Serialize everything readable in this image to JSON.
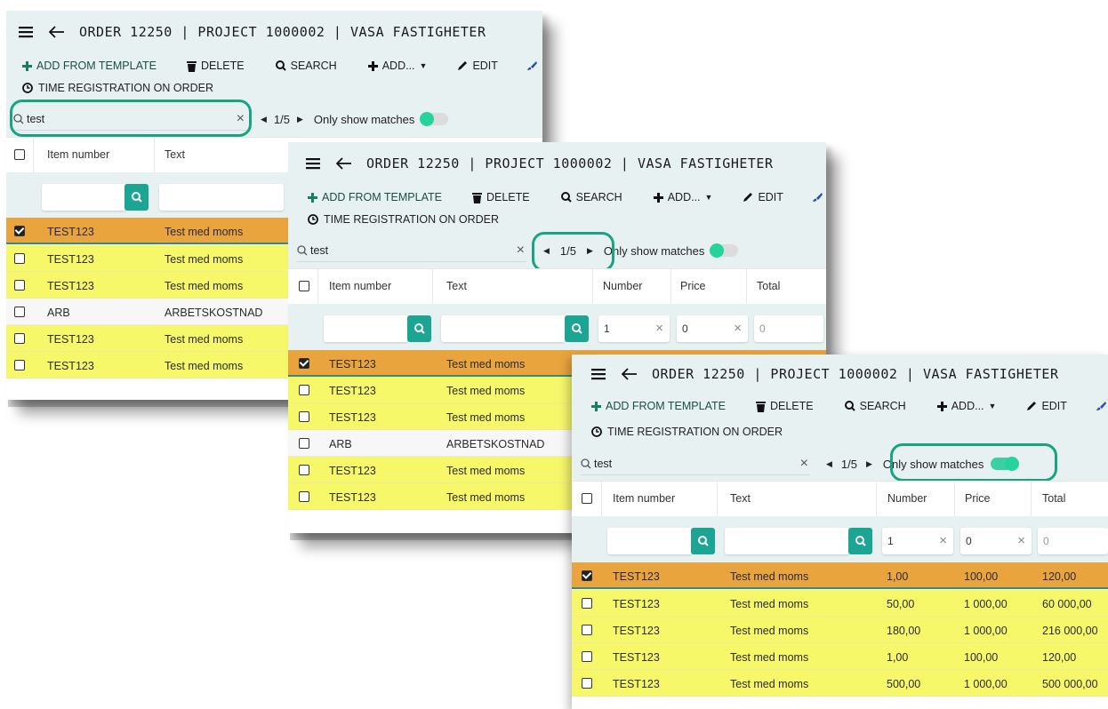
{
  "header": {
    "title": "ORDER 12250 | PROJECT 1000002 | VASA FASTIGHETER"
  },
  "toolbar": {
    "add_from_template": "ADD FROM TEMPLATE",
    "delete": "DELETE",
    "search": "SEARCH",
    "add": "ADD...",
    "edit": "EDIT",
    "time_registration": "TIME REGISTRATION ON ORDER"
  },
  "search": {
    "value": "test",
    "position": "1/5",
    "only_show_matches": "Only show matches"
  },
  "table": {
    "columns": [
      "Item number",
      "Text",
      "Number",
      "Price",
      "Total"
    ],
    "filters": {
      "number": "1",
      "price": "0",
      "total": "0"
    },
    "rows_all": [
      {
        "item": "TEST123",
        "text": "Test med moms",
        "state": "selected"
      },
      {
        "item": "TEST123",
        "text": "Test med moms",
        "state": "match"
      },
      {
        "item": "TEST123",
        "text": "Test med moms",
        "state": "match"
      },
      {
        "item": "ARB",
        "text": "ARBETSKOSTNAD",
        "state": "plain"
      },
      {
        "item": "TEST123",
        "text": "Test med moms",
        "state": "match"
      },
      {
        "item": "TEST123",
        "text": "Test med moms",
        "state": "match"
      }
    ],
    "rows_filtered": [
      {
        "item": "TEST123",
        "text": "Test med moms",
        "number": "1,00",
        "price": "100,00",
        "total": "120,00",
        "state": "selected"
      },
      {
        "item": "TEST123",
        "text": "Test med moms",
        "number": "50,00",
        "price": "1 000,00",
        "total": "60 000,00",
        "state": "match"
      },
      {
        "item": "TEST123",
        "text": "Test med moms",
        "number": "180,00",
        "price": "1 000,00",
        "total": "216 000,00",
        "state": "match"
      },
      {
        "item": "TEST123",
        "text": "Test med moms",
        "number": "1,00",
        "price": "100,00",
        "total": "120,00",
        "state": "match"
      },
      {
        "item": "TEST123",
        "text": "Test med moms",
        "number": "500,00",
        "price": "1 000,00",
        "total": "500 000,00",
        "state": "match"
      }
    ]
  },
  "colors": {
    "header_bg": "#e8f1f2",
    "selected_row": "#e9a43e",
    "match_row": "#f7f76a",
    "accent": "#1ba592",
    "highlight_oval": "#18a382"
  },
  "icons": [
    "menu-icon",
    "back-arrow-icon",
    "plus-icon",
    "trash-icon",
    "search-icon",
    "brush-icon",
    "clock-icon",
    "clear-icon",
    "caret-left-icon",
    "caret-right-icon",
    "checkbox-icon",
    "pencil-icon"
  ]
}
